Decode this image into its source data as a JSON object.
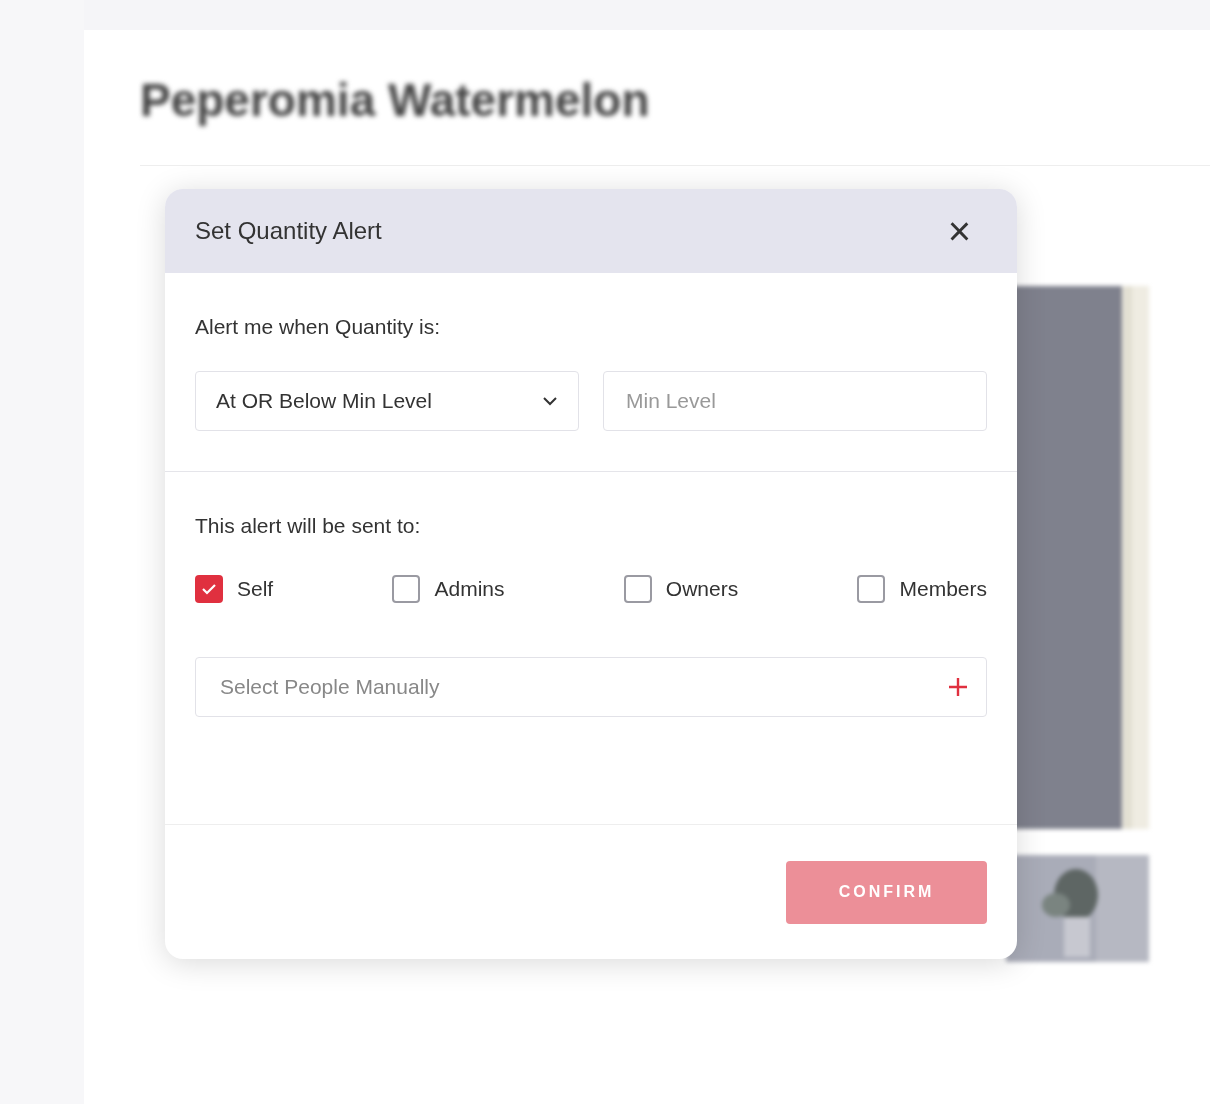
{
  "page": {
    "title": "Peperomia Watermelon"
  },
  "dialog": {
    "title": "Set Quantity Alert",
    "close_icon": "×",
    "condition_label": "Alert me when Quantity is:",
    "condition_select": {
      "value": "At OR Below Min Level"
    },
    "min_level": {
      "placeholder": "Min Level"
    },
    "recipients_label": "This alert will be sent to:",
    "recipients": [
      {
        "label": "Self",
        "checked": true
      },
      {
        "label": "Admins",
        "checked": false
      },
      {
        "label": "Owners",
        "checked": false
      },
      {
        "label": "Members",
        "checked": false
      }
    ],
    "people_field": {
      "placeholder": "Select People Manually"
    },
    "confirm_button": {
      "label": "CONFIRM",
      "disabled": true
    }
  }
}
